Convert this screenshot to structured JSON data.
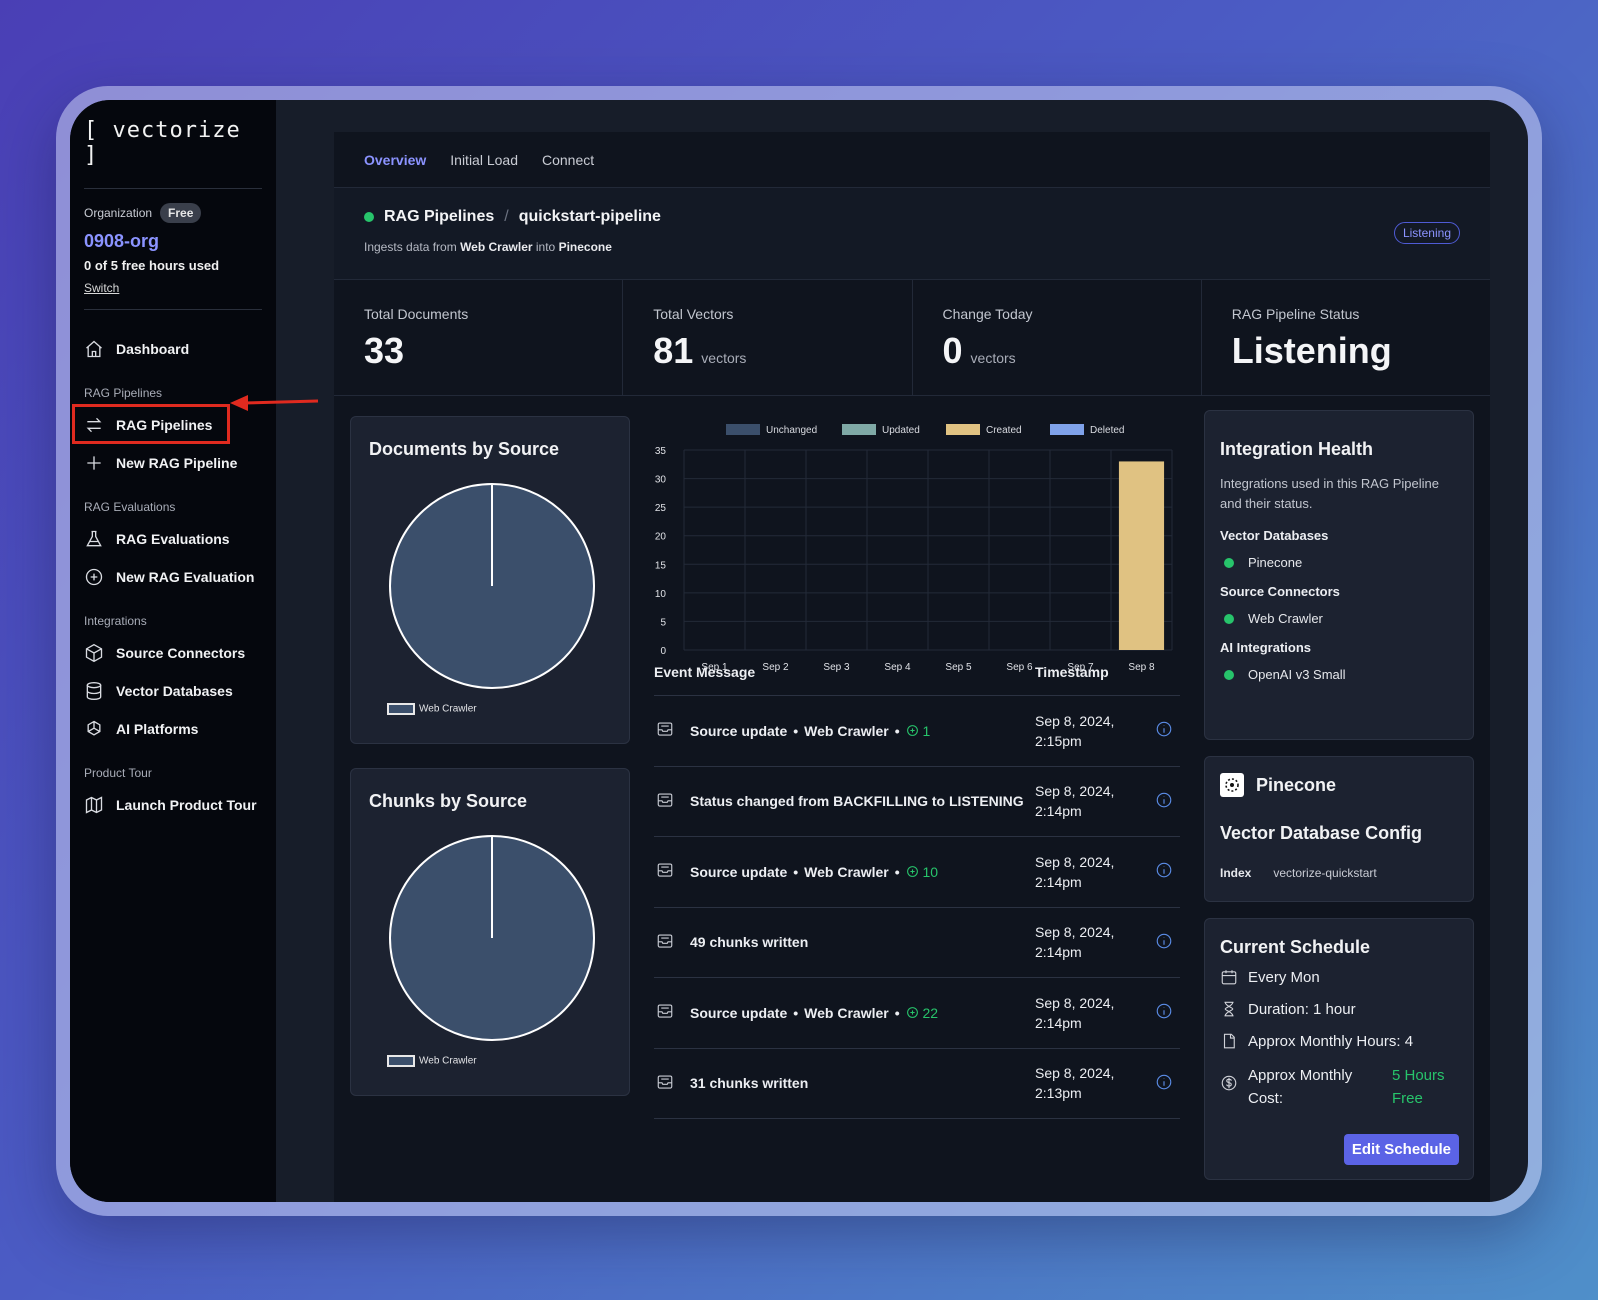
{
  "sidebar": {
    "logo": "[ vectorize ]",
    "org_label": "Organization",
    "plan_badge": "Free",
    "org_name": "0908-org",
    "hours_used": "0 of 5 free hours used",
    "switch_label": "Switch",
    "dashboard": "Dashboard",
    "sections": {
      "rag_pipelines": "RAG Pipelines",
      "rag_evaluations": "RAG Evaluations",
      "integrations": "Integrations",
      "product_tour": "Product Tour"
    },
    "items": {
      "rag_pipelines": "RAG Pipelines",
      "new_rag_pipeline": "New RAG Pipeline",
      "rag_evaluations": "RAG Evaluations",
      "new_rag_evaluation": "New RAG Evaluation",
      "source_connectors": "Source Connectors",
      "vector_databases": "Vector Databases",
      "ai_platforms": "AI Platforms",
      "launch_product_tour": "Launch Product Tour"
    }
  },
  "tabs": [
    "Overview",
    "Initial Load",
    "Connect"
  ],
  "pipeline": {
    "crumb_root": "RAG Pipelines",
    "crumb_sep": "/",
    "name": "quickstart-pipeline",
    "ingest_prefix": "Ingests data from",
    "source": "Web Crawler",
    "ingest_mid": "into",
    "destination": "Pinecone",
    "status_badge": "Listening"
  },
  "stats": {
    "total_documents_label": "Total Documents",
    "total_documents": "33",
    "total_vectors_label": "Total Vectors",
    "total_vectors": "81",
    "vectors_unit": "vectors",
    "change_today_label": "Change Today",
    "change_today": "0",
    "status_label": "RAG Pipeline Status",
    "status_value": "Listening"
  },
  "documents_by_source": {
    "title": "Documents by Source",
    "legend": "Web Crawler"
  },
  "chunks_by_source": {
    "title": "Chunks by Source",
    "legend": "Web Crawler"
  },
  "chart_data": {
    "type": "bar",
    "categories": [
      "Sep 1",
      "Sep 2",
      "Sep 3",
      "Sep 4",
      "Sep 5",
      "Sep 6",
      "Sep 7",
      "Sep 8"
    ],
    "series": [
      {
        "name": "Unchanged",
        "color": "#3b4f6b",
        "values": [
          0,
          0,
          0,
          0,
          0,
          0,
          0,
          0
        ]
      },
      {
        "name": "Updated",
        "color": "#7fa9a6",
        "values": [
          0,
          0,
          0,
          0,
          0,
          0,
          0,
          0
        ]
      },
      {
        "name": "Created",
        "color": "#e0c282",
        "values": [
          0,
          0,
          0,
          0,
          0,
          0,
          0,
          33
        ]
      },
      {
        "name": "Deleted",
        "color": "#7fa2ea",
        "values": [
          0,
          0,
          0,
          0,
          0,
          0,
          0,
          0
        ]
      }
    ],
    "yticks": [
      0,
      5,
      10,
      15,
      20,
      25,
      30,
      35
    ],
    "ylim": [
      0,
      35
    ],
    "legend": "top"
  },
  "events": {
    "header_message": "Event Message",
    "header_timestamp": "Timestamp",
    "rows": [
      {
        "message": "Source update",
        "source": "Web Crawler",
        "count": "1",
        "date": "Sep 8, 2024,",
        "time": "2:15pm"
      },
      {
        "message": "Status changed from BACKFILLING to LISTENING",
        "source": "",
        "count": "",
        "date": "Sep 8, 2024,",
        "time": "2:14pm"
      },
      {
        "message": "Source update",
        "source": "Web Crawler",
        "count": "10",
        "date": "Sep 8, 2024,",
        "time": "2:14pm"
      },
      {
        "message": "49 chunks written",
        "source": "",
        "count": "",
        "date": "Sep 8, 2024,",
        "time": "2:14pm"
      },
      {
        "message": "Source update",
        "source": "Web Crawler",
        "count": "22",
        "date": "Sep 8, 2024,",
        "time": "2:14pm"
      },
      {
        "message": "31 chunks written",
        "source": "",
        "count": "",
        "date": "Sep 8, 2024,",
        "time": "2:13pm"
      }
    ]
  },
  "integration_health": {
    "title": "Integration Health",
    "description": "Integrations used in this RAG Pipeline and their status.",
    "vector_db_label": "Vector Databases",
    "vector_db": "Pinecone",
    "source_label": "Source Connectors",
    "source": "Web Crawler",
    "ai_label": "AI Integrations",
    "ai": "OpenAI v3 Small"
  },
  "vector_config": {
    "provider": "Pinecone",
    "title": "Vector Database Config",
    "index_label": "Index",
    "index_value": "vectorize-quickstart"
  },
  "schedule": {
    "title": "Current Schedule",
    "frequency": "Every Mon",
    "duration": "Duration: 1 hour",
    "monthly_hours": "Approx Monthly Hours: 4",
    "cost_label_1": "Approx Monthly",
    "cost_label_2": "Cost:",
    "cost_value_1": "5 Hours",
    "cost_value_2": "Free",
    "edit_button": "Edit Schedule"
  }
}
